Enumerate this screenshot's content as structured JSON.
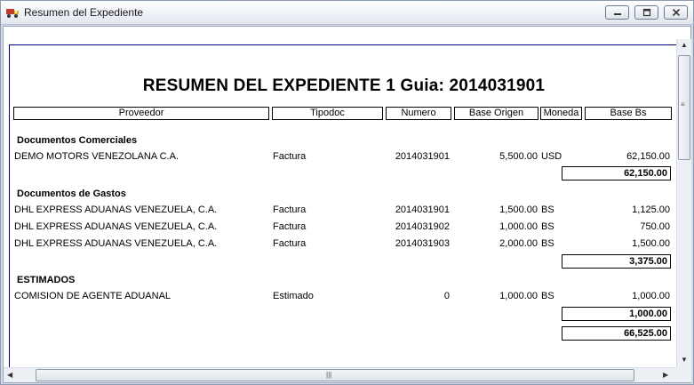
{
  "window": {
    "title": "Resumen del Expediente"
  },
  "report": {
    "title": "RESUMEN DEL EXPEDIENTE 1 Guia: 2014031901",
    "headers": {
      "proveedor": "Proveedor",
      "tipodoc": "Tipodoc",
      "numero": "Numero",
      "base_origen": "Base Origen",
      "moneda": "Moneda",
      "base_bs": "Base Bs"
    },
    "sections": [
      {
        "title": "Documentos Comerciales",
        "rows": [
          {
            "proveedor": "DEMO MOTORS VENEZOLANA C.A.",
            "tipodoc": "Factura",
            "numero": "2014031901",
            "base_origen": "5,500.00",
            "moneda": "USD",
            "base_bs": "62,150.00"
          }
        ],
        "total": "62,150.00"
      },
      {
        "title": "Documentos de Gastos",
        "rows": [
          {
            "proveedor": "DHL EXPRESS ADUANAS VENEZUELA, C.A.",
            "tipodoc": "Factura",
            "numero": "2014031901",
            "base_origen": "1,500.00",
            "moneda": "BS",
            "base_bs": "1,125.00"
          },
          {
            "proveedor": "DHL EXPRESS ADUANAS VENEZUELA, C.A.",
            "tipodoc": "Factura",
            "numero": "2014031902",
            "base_origen": "1,000.00",
            "moneda": "BS",
            "base_bs": "750.00"
          },
          {
            "proveedor": "DHL EXPRESS ADUANAS VENEZUELA, C.A.",
            "tipodoc": "Factura",
            "numero": "2014031903",
            "base_origen": "2,000.00",
            "moneda": "BS",
            "base_bs": "1,500.00"
          }
        ],
        "total": "3,375.00"
      },
      {
        "title": "ESTIMADOS",
        "rows": [
          {
            "proveedor": "COMISION DE AGENTE ADUANAL",
            "tipodoc": "Estimado",
            "numero": "0",
            "base_origen": "1,000.00",
            "moneda": "BS",
            "base_bs": "1,000.00"
          }
        ],
        "total": "1,000.00"
      }
    ],
    "grand_total": "66,525.00"
  },
  "icons": {
    "app": "truck-icon",
    "minimize": "minimize-icon",
    "maximize": "maximize-icon",
    "close": "close-icon"
  }
}
